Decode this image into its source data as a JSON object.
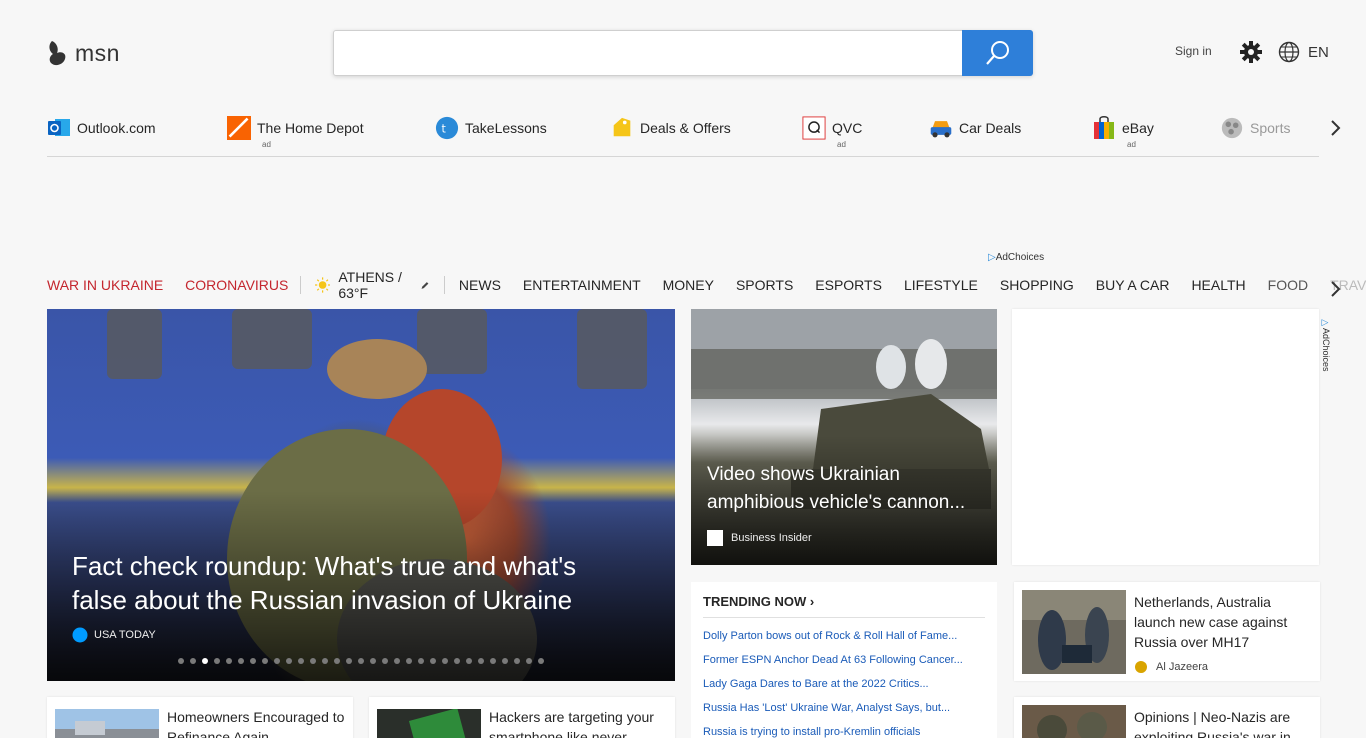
{
  "header": {
    "logo_text": "msn",
    "search_placeholder": "",
    "sign_in": "Sign in",
    "language": "EN"
  },
  "quicklinks": {
    "items": [
      {
        "label": "Outlook.com",
        "ad": ""
      },
      {
        "label": "The Home Depot",
        "ad": "ad"
      },
      {
        "label": "TakeLessons",
        "ad": ""
      },
      {
        "label": "Deals & Offers",
        "ad": ""
      },
      {
        "label": "QVC",
        "ad": "ad"
      },
      {
        "label": "Car Deals",
        "ad": ""
      },
      {
        "label": "eBay",
        "ad": "ad"
      },
      {
        "label": "Sports",
        "ad": ""
      }
    ]
  },
  "adchoices": "AdChoices",
  "nav": {
    "war": "WAR IN UKRAINE",
    "corona": "CORONAVIRUS",
    "weather": "ATHENS / 63°F",
    "items": [
      "NEWS",
      "ENTERTAINMENT",
      "MONEY",
      "SPORTS",
      "ESPORTS",
      "LIFESTYLE",
      "SHOPPING",
      "BUY A CAR",
      "HEALTH",
      "FOOD",
      "TRAVEL"
    ]
  },
  "hero": {
    "title": "Fact check roundup: What's true and what's false about the Russian invasion of Ukraine",
    "source": "USA TODAY",
    "slide_count": 31,
    "active_slide": 3
  },
  "card2": {
    "title": "Video shows Ukrainian amphibious vehicle's cannon...",
    "source": "Business Insider"
  },
  "trending": {
    "heading": "TRENDING NOW",
    "links": [
      "Dolly Parton bows out of Rock & Roll Hall of Fame...",
      "Former ESPN Anchor Dead At 63 Following Cancer...",
      "Lady Gaga Dares to Bare at the 2022 Critics...",
      "Russia Has 'Lost' Ukraine War, Analyst Says, but...",
      "Russia is trying to install pro-Kremlin officials"
    ]
  },
  "side_card1": {
    "title": "Netherlands, Australia launch new case against Russia over MH17",
    "source": "Al Jazeera"
  },
  "side_card2": {
    "title": "Opinions | Neo-Nazis are exploiting Russia's war in"
  },
  "bottom_cards": [
    {
      "title": "Homeowners Encouraged to Refinance Again"
    },
    {
      "title": "Hackers are targeting your smartphone like never"
    }
  ],
  "colors": {
    "accent": "#2e7fd9",
    "nav_red": "#c4262e",
    "link": "#1a5bb8"
  }
}
